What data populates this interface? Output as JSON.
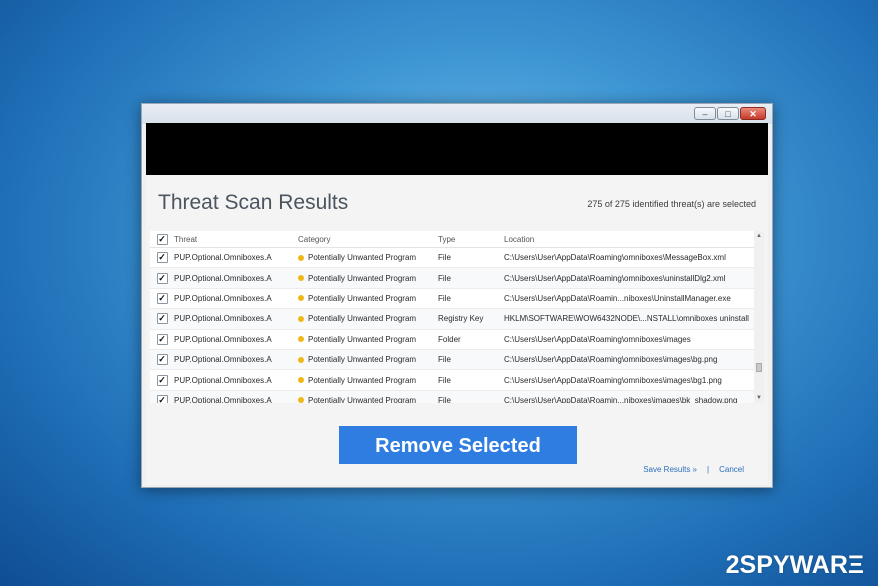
{
  "window": {
    "minimize_glyph": "–",
    "maximize_glyph": "□",
    "close_glyph": "✕"
  },
  "page_title": "Threat Scan Results",
  "selection_info": "275 of 275 identified threat(s) are selected",
  "table": {
    "headers": {
      "threat": "Threat",
      "category": "Category",
      "type": "Type",
      "location": "Location"
    },
    "rows": [
      {
        "threat": "PUP.Optional.Omniboxes.A",
        "category": "Potentially Unwanted Program",
        "type": "File",
        "location": "C:\\Users\\User\\AppData\\Roaming\\omniboxes\\MessageBox.xml"
      },
      {
        "threat": "PUP.Optional.Omniboxes.A",
        "category": "Potentially Unwanted Program",
        "type": "File",
        "location": "C:\\Users\\User\\AppData\\Roaming\\omniboxes\\uninstallDlg2.xml"
      },
      {
        "threat": "PUP.Optional.Omniboxes.A",
        "category": "Potentially Unwanted Program",
        "type": "File",
        "location": "C:\\Users\\User\\AppData\\Roamin...niboxes\\UninstallManager.exe"
      },
      {
        "threat": "PUP.Optional.Omniboxes.A",
        "category": "Potentially Unwanted Program",
        "type": "Registry Key",
        "location": "HKLM\\SOFTWARE\\WOW6432NODE\\...NSTALL\\omniboxes uninstall"
      },
      {
        "threat": "PUP.Optional.Omniboxes.A",
        "category": "Potentially Unwanted Program",
        "type": "Folder",
        "location": "C:\\Users\\User\\AppData\\Roaming\\omniboxes\\images"
      },
      {
        "threat": "PUP.Optional.Omniboxes.A",
        "category": "Potentially Unwanted Program",
        "type": "File",
        "location": "C:\\Users\\User\\AppData\\Roaming\\omniboxes\\images\\bg.png"
      },
      {
        "threat": "PUP.Optional.Omniboxes.A",
        "category": "Potentially Unwanted Program",
        "type": "File",
        "location": "C:\\Users\\User\\AppData\\Roaming\\omniboxes\\images\\bg1.png"
      },
      {
        "threat": "PUP.Optional.Omniboxes.A",
        "category": "Potentially Unwanted Program",
        "type": "File",
        "location": "C:\\Users\\User\\AppData\\Roamin...niboxes\\images\\bk_shadow.png"
      }
    ]
  },
  "remove_button_label": "Remove Selected",
  "save_results_label": "Save Results »",
  "links_separator": "|",
  "cancel_label": "Cancel",
  "checkmark": "✓",
  "watermark": "2SPYWARΞ",
  "colors": {
    "accent_button": "#2f7de1",
    "category_dot": "#f0b817",
    "link": "#2d6fbd"
  }
}
